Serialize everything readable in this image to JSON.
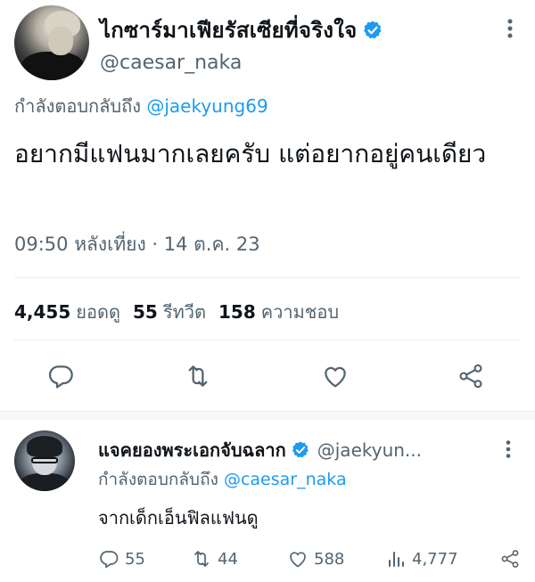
{
  "main_tweet": {
    "display_name": "ไกซาร์มาเฟียรัสเซียที่จริงใจ",
    "handle": "@caesar_naka",
    "reply_prefix": "กำลังตอบกลับถึง",
    "reply_mention": "@jaekyung69",
    "text": "อยากมีแฟนมากเลยครับ แต่อยากอยู่คนเดียว",
    "timestamp": "09:50 หลังเที่ยง · 14 ต.ค. 23",
    "stats": {
      "views_count": "4,455",
      "views_label": "ยอดดู",
      "retweets_count": "55",
      "retweets_label": "รีทวีต",
      "likes_count": "158",
      "likes_label": "ความชอบ"
    }
  },
  "reply_tweet": {
    "display_name": "แจคยองพระเอกจับฉลาก",
    "handle": "@jaekyun...",
    "reply_prefix": "กำลังตอบกลับถึง",
    "reply_mention": "@caesar_naka",
    "text": "จากเด็กเอ็นฟิลแฟนดู",
    "actions": {
      "replies": "55",
      "retweets": "44",
      "likes": "588",
      "views": "4,777"
    }
  },
  "colors": {
    "accent": "#1d9bf0",
    "text": "#0f1419",
    "muted": "#536471"
  },
  "icons": [
    "verified-badge-icon",
    "more-options-icon",
    "reply-icon",
    "retweet-icon",
    "like-icon",
    "share-icon",
    "views-icon"
  ]
}
